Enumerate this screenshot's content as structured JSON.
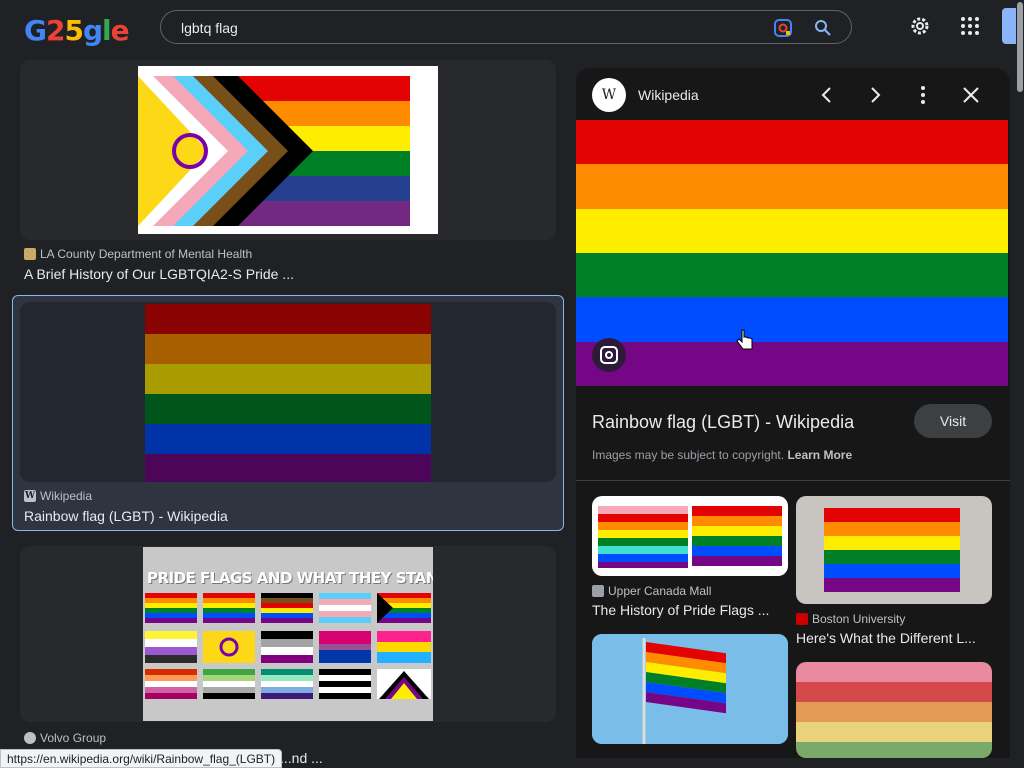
{
  "logo": {
    "text": "G25gle"
  },
  "search": {
    "query": "lgbtq flag"
  },
  "results": [
    {
      "source": "LA County Department of Mental Health",
      "title": "A Brief History of Our LGBTQIA2-S Pride ..."
    },
    {
      "source": "Wikipedia",
      "title": "Rainbow flag (LGBT) - Wikipedia"
    },
    {
      "source": "Volvo Group",
      "title": "...nd ...",
      "image_text": "PRIDE FLAGS AND WHAT THEY STAND FOR"
    }
  ],
  "panel": {
    "site": "Wikipedia",
    "favicon": "W",
    "title": "Rainbow flag (LGBT) - Wikipedia",
    "visit_label": "Visit",
    "copyright": "Images may be subject to copyright.",
    "learn_more": "Learn More",
    "related": [
      {
        "source": "Upper Canada Mall",
        "title": "The History of Pride Flags ..."
      },
      {
        "source": "Boston University",
        "title": "Here's What the Different L..."
      }
    ]
  },
  "status_url": "https://en.wikipedia.org/wiki/Rainbow_flag_(LGBT)",
  "colors": {
    "accent": "#8ab4f8",
    "rainbow": [
      "#e40303",
      "#ff8c00",
      "#ffed00",
      "#008026",
      "#004dff",
      "#750787"
    ]
  }
}
